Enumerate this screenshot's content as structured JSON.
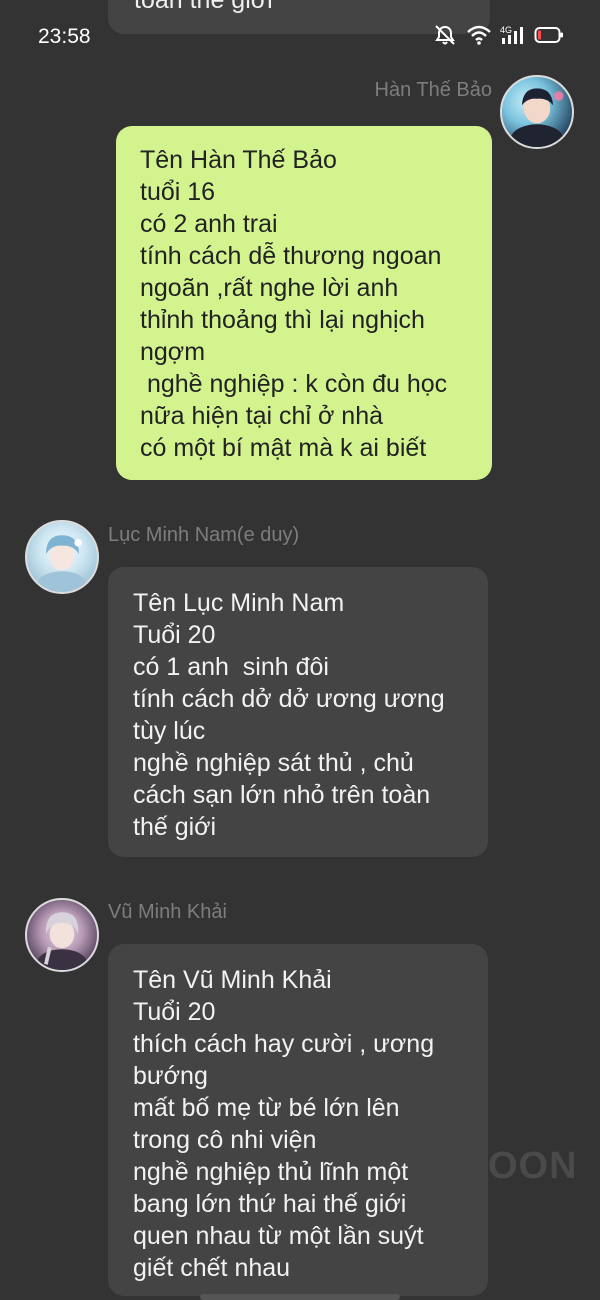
{
  "status_bar": {
    "time": "23:58",
    "icons": [
      "mute-icon",
      "wifi-icon",
      "4g-signal-icon",
      "battery-low-icon"
    ],
    "network_label": "4G"
  },
  "colors": {
    "background": "#333333",
    "user_bubble": "#d3f38f",
    "npc_bubble": "#444444",
    "name_text": "#7d7d7d",
    "battery_alert": "#ff4d4d"
  },
  "messages": [
    {
      "role": "partial",
      "text": "toàn thế giới"
    },
    {
      "role": "user",
      "sender": "Hàn Thế Bảo",
      "text": "Tên Hàn Thế Bảo\ntuổi 16\ncó 2 anh trai\ntính cách dễ thương ngoan ngoãn ,rất nghe lời anh\nthỉnh thoảng thì lại nghịch ngợm\n nghề nghiệp : k còn đu học nữa hiện tại chỉ ở nhà\ncó một bí mật mà k ai biết"
    },
    {
      "role": "npc",
      "sender": "Lục Minh Nam(e duy)",
      "text": "Tên Lục Minh Nam\nTuổi 20\ncó 1 anh  sinh đôi\ntính cách dở dở ương ương tùy lúc\nnghề nghiệp sát thủ , chủ cách sạn lớn nhỏ trên toàn thế giới"
    },
    {
      "role": "npc",
      "sender": "Vũ Minh Khải",
      "text": "Tên Vũ Minh Khải\nTuổi 20\nthích cách hay cười , ương bướng\nmất bố mẹ từ bé lớn lên trong cô nhi viện\nnghề nghiệp thủ lĩnh một bang lớn thứ hai thế giới\nquen nhau từ một lần suýt giết chết nhau"
    }
  ],
  "watermark": "OON"
}
